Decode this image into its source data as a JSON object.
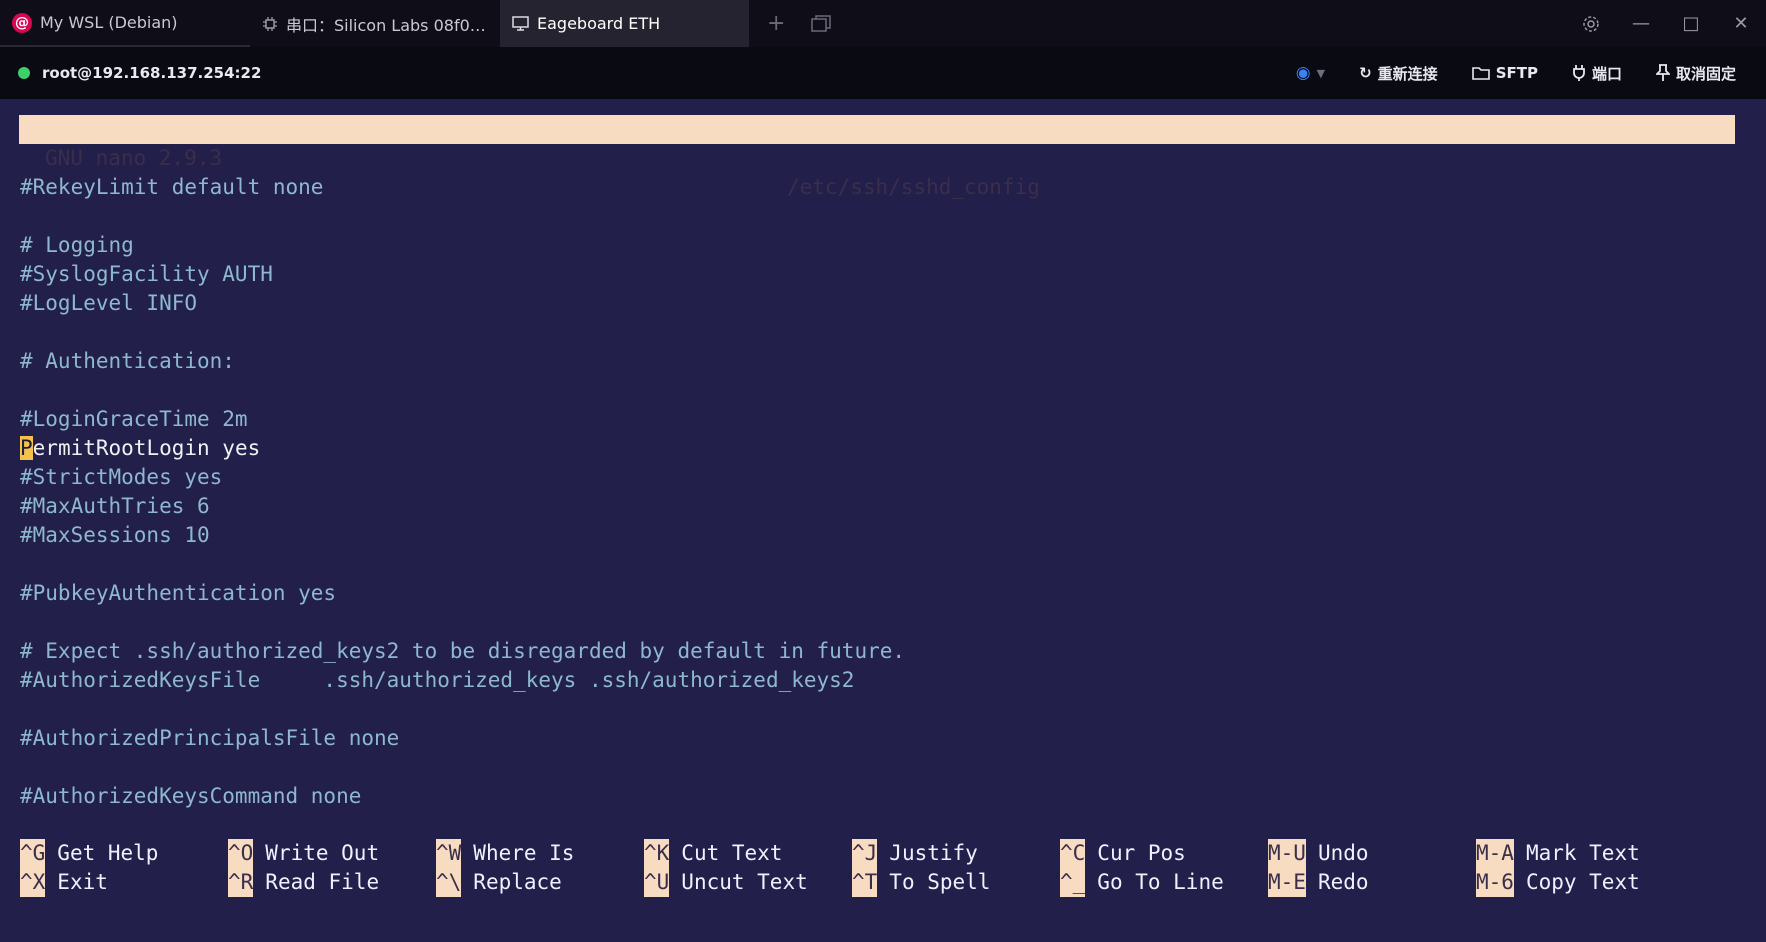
{
  "tabs": [
    {
      "label": "My WSL (Debian)",
      "icon": "debian-icon"
    },
    {
      "label": "串口：Silicon Labs 08f0…",
      "icon": "chip-icon"
    },
    {
      "label": "Eageboard ETH",
      "icon": "monitor-icon",
      "active": true
    }
  ],
  "session": {
    "host": "root@192.168.137.254:22",
    "status_color": "#3ecf6a",
    "actions": {
      "reconnect": "重新连接",
      "sftp": "SFTP",
      "port": "端口",
      "unpin": "取消固定"
    }
  },
  "nano": {
    "version": "GNU nano 2.9.3",
    "filename": "/etc/ssh/sshd_config"
  },
  "lines": [
    "#RekeyLimit default none",
    "",
    "# Logging",
    "#SyslogFacility AUTH",
    "#LogLevel INFO",
    "",
    "# Authentication:",
    "",
    "#LoginGraceTime 2m",
    "PermitRootLogin yes",
    "#StrictModes yes",
    "#MaxAuthTries 6",
    "#MaxSessions 10",
    "",
    "#PubkeyAuthentication yes",
    "",
    "# Expect .ssh/authorized_keys2 to be disregarded by default in future.",
    "#AuthorizedKeysFile     .ssh/authorized_keys .ssh/authorized_keys2",
    "",
    "#AuthorizedPrincipalsFile none",
    "",
    "#AuthorizedKeysCommand none"
  ],
  "cursor_line": {
    "cursor_char": "P",
    "rest": "ermitRootLogin yes"
  },
  "shortcuts": [
    {
      "key": "^G",
      "label": "Get Help"
    },
    {
      "key": "^O",
      "label": "Write Out"
    },
    {
      "key": "^W",
      "label": "Where Is"
    },
    {
      "key": "^K",
      "label": "Cut Text"
    },
    {
      "key": "^J",
      "label": "Justify"
    },
    {
      "key": "^C",
      "label": "Cur Pos"
    },
    {
      "key": "M-U",
      "label": "Undo"
    },
    {
      "key": "M-A",
      "label": "Mark Text"
    },
    {
      "key": "^X",
      "label": "Exit"
    },
    {
      "key": "^R",
      "label": "Read File"
    },
    {
      "key": "^\\",
      "label": "Replace"
    },
    {
      "key": "^U",
      "label": "Uncut Text"
    },
    {
      "key": "^T",
      "label": "To Spell"
    },
    {
      "key": "^_",
      "label": "Go To Line"
    },
    {
      "key": "M-E",
      "label": "Redo"
    },
    {
      "key": "M-6",
      "label": "Copy Text"
    }
  ]
}
